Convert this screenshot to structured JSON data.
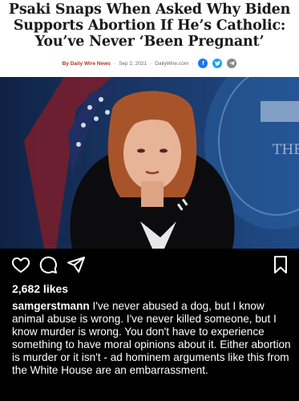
{
  "article": {
    "headline": "Psaki Snaps When Asked Why Biden Supports Abortion If He’s Catholic: You’ve Never ‘Been Pregnant’",
    "author": "By Daily Wire News",
    "date": "Sep 2, 2021",
    "source": "DailyWire.com",
    "share_icons": [
      "facebook-icon",
      "twitter-icon",
      "telegram-icon"
    ],
    "background_text": "THE"
  },
  "post": {
    "likes": "2,682 likes",
    "username": "samgerstmann",
    "caption": " I've never abused a dog, but I know animal abuse is wrong. I've never killed someone, but I know murder is wrong. You don't have to experience something to have moral opinions about it. Either abortion is murder or it isn't - ad hominem arguments like this from the White House are an embarrassment."
  },
  "colors": {
    "author_red": "#b0332a",
    "facebook_blue": "#1877f2",
    "twitter_blue": "#1da1f2",
    "telegram_gray": "#888888",
    "background": "#000000"
  }
}
